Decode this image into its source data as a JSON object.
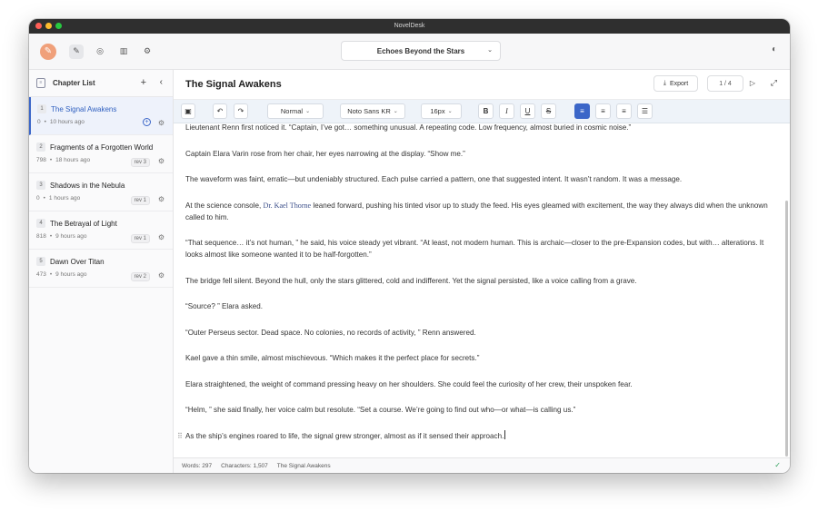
{
  "window": {
    "title": "NovelDesk"
  },
  "appbar": {
    "logo_glyph": "✎",
    "tools": [
      {
        "name": "pen-icon",
        "glyph": "✎",
        "active": true
      },
      {
        "name": "globe-icon",
        "glyph": "◎",
        "active": false
      },
      {
        "name": "chart-icon",
        "glyph": "▥",
        "active": false
      },
      {
        "name": "gear-icon",
        "glyph": "⚙",
        "active": false
      }
    ],
    "document": "Echoes Beyond the Stars",
    "palette_glyph": "◐"
  },
  "sidebar": {
    "title": "Chapter List",
    "add_glyph": "+",
    "collapse_glyph": "‹",
    "chapters": [
      {
        "num": "1",
        "title": "The Signal Awakens",
        "words": "0",
        "time": "10 hours ago",
        "rev": "",
        "active": true
      },
      {
        "num": "2",
        "title": "Fragments of a Forgotten World",
        "words": "798",
        "time": "18 hours ago",
        "rev": "rev 3",
        "active": false
      },
      {
        "num": "3",
        "title": "Shadows in the Nebula",
        "words": "0",
        "time": "1 hours ago",
        "rev": "rev 1",
        "active": false
      },
      {
        "num": "4",
        "title": "The Betrayal of Light",
        "words": "818",
        "time": "9 hours ago",
        "rev": "rev 1",
        "active": false
      },
      {
        "num": "5",
        "title": "Dawn Over Titan",
        "words": "473",
        "time": "9 hours ago",
        "rev": "rev 2",
        "active": false
      }
    ]
  },
  "editor": {
    "title": "The Signal Awakens",
    "export_label": "Export",
    "page_indicator": "1 / 4",
    "toolbar": {
      "style": "Normal",
      "font": "Noto Sans KR",
      "size": "16px"
    },
    "paragraphs": [
      "Lieutenant Renn first noticed it. “Captain, I’ve got… something unusual. A repeating code. Low frequency, almost buried in cosmic noise.”",
      "Captain Elara Varin rose from her chair, her eyes narrowing at the display. “Show me.”",
      "The waveform was faint, erratic—but undeniably structured. Each pulse carried a pattern, one that suggested intent. It wasn’t random. It was a message.",
      "__P4__",
      "“That sequence… it’s not human, ” he said, his voice steady yet vibrant. “At least, not modern human. This is archaic—closer to the pre-Expansion codes, but with… alterations. It looks almost like someone wanted it to be half-forgotten.”",
      "The bridge fell silent. Beyond the hull, only the stars glittered, cold and indifferent. Yet the signal persisted, like a voice calling from a grave.",
      "“Source? ” Elara asked.",
      "“Outer Perseus sector. Dead space. No colonies, no records of activity, ” Renn answered.",
      "Kael gave a thin smile, almost mischievous. “Which makes it the perfect place for secrets.”",
      "Elara straightened, the weight of command pressing heavy on her shoulders. She could feel the curiosity of her crew, their unspoken fear.",
      "“Helm, ” she said finally, her voice calm but resolute. “Set a course. We’re going to find out who—or what—is calling us.”",
      "As the ship’s engines roared to life, the signal grew stronger, almost as if it sensed their approach."
    ],
    "p4": {
      "before": "At the science console, ",
      "name": "Dr. Kael Thorne",
      "after": " leaned forward, pushing his tinted visor up to study the feed. His eyes gleamed with excitement, the way they always did when the unknown called to him."
    }
  },
  "status": {
    "words": "Words: 297",
    "characters": "Characters: 1,507",
    "chapter": "The Signal Awakens",
    "ok_glyph": "✓"
  }
}
